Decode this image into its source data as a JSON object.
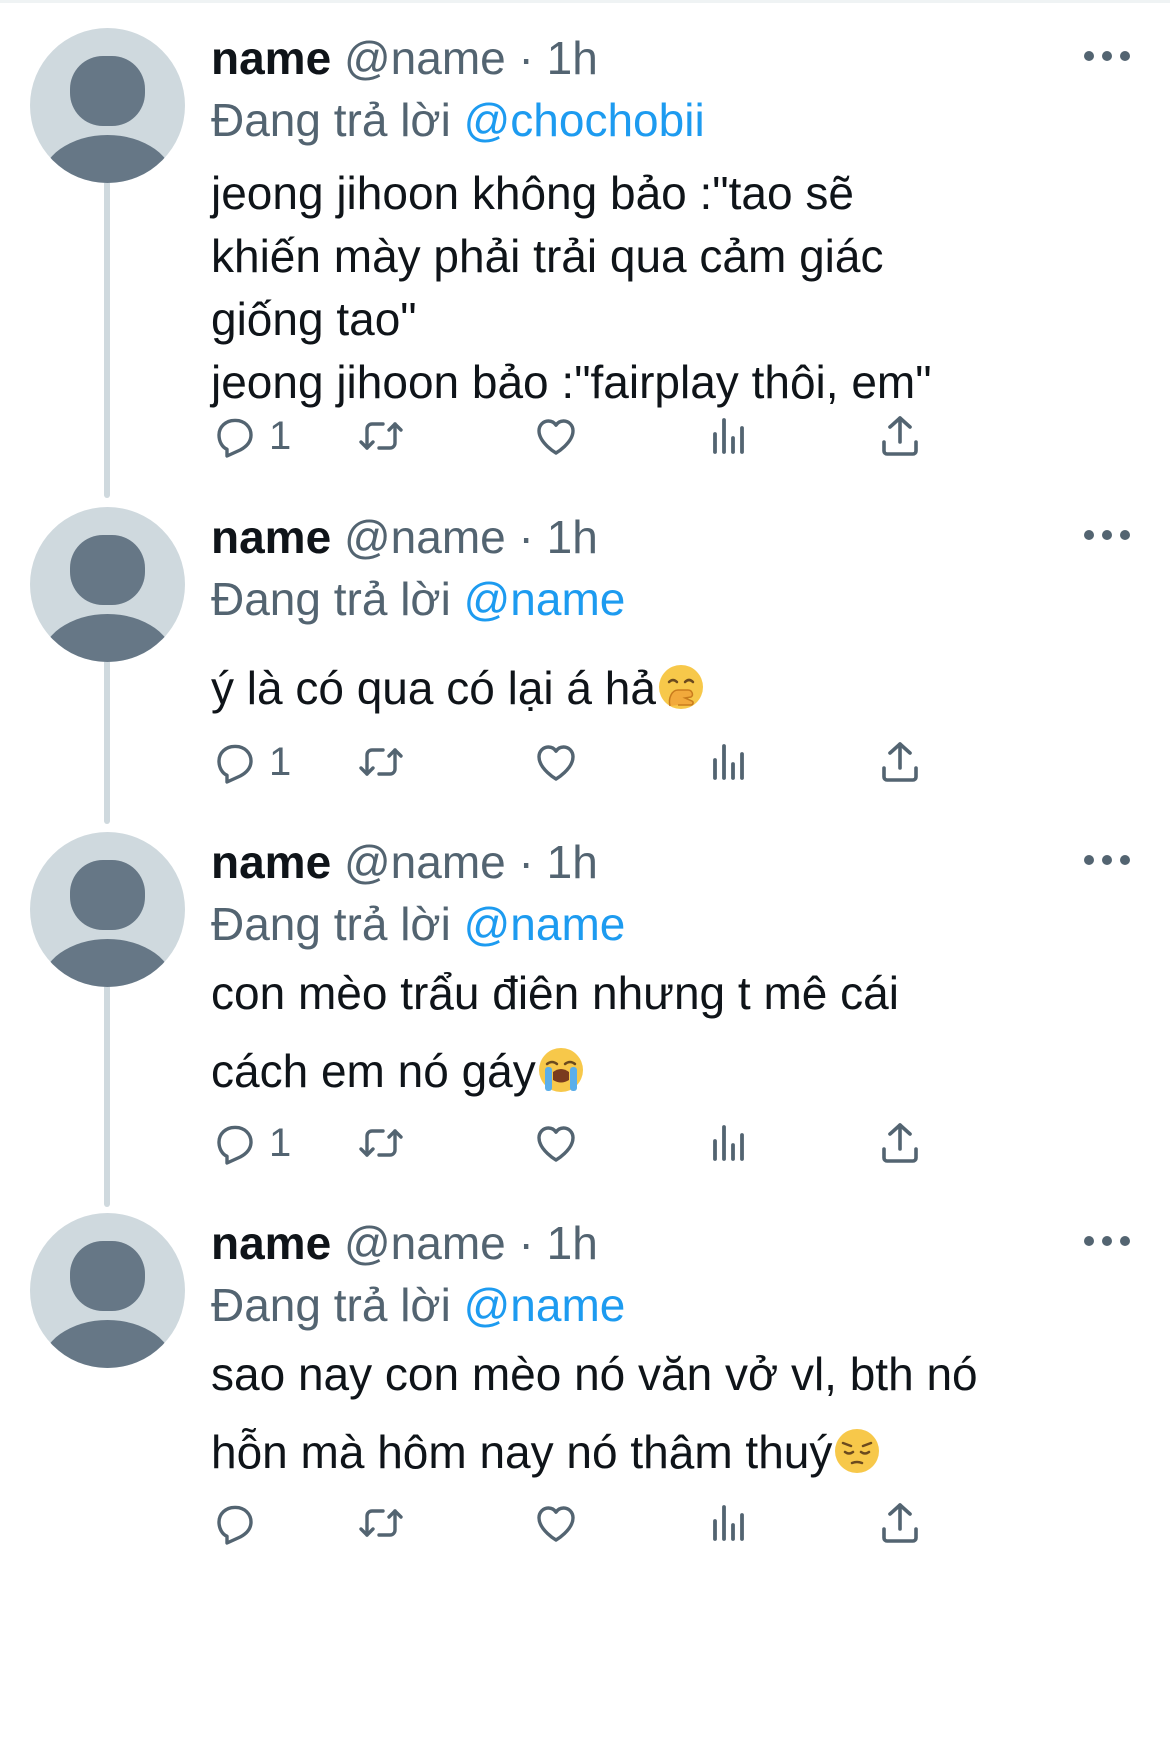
{
  "tweets": [
    {
      "name": "name",
      "handle": "@name",
      "dot": "·",
      "time": "1h",
      "reply_prefix": "Đang trả lời",
      "reply_to": "@chochobii",
      "text": "jeong jihoon không bảo :\"tao sẽ\nkhiến mày phải trải qua cảm giác\ngiống tao\"\njeong jihoon bảo :\"fairplay thôi, em\"",
      "emoji": "",
      "reply_count": "1"
    },
    {
      "name": "name",
      "handle": "@name",
      "dot": "·",
      "time": "1h",
      "reply_prefix": "Đang trả lời",
      "reply_to": "@name",
      "text": "ý là có qua có lại á hả",
      "emoji": "hand-over-mouth-emoji",
      "reply_count": "1"
    },
    {
      "name": "name",
      "handle": "@name",
      "dot": "·",
      "time": "1h",
      "reply_prefix": "Đang trả lời",
      "reply_to": "@name",
      "text": "con mèo trẩu điên nhưng t mê cái\ncách em nó gáy",
      "emoji": "loudly-crying-emoji",
      "reply_count": "1"
    },
    {
      "name": "name",
      "handle": "@name",
      "dot": "·",
      "time": "1h",
      "reply_prefix": "Đang trả lời",
      "reply_to": "@name",
      "text": "sao nay con mèo nó văn vở vl, bth nó\nhỗn mà hôm nay nó thâm thuý",
      "emoji": "pensive-emoji",
      "reply_count": ""
    }
  ],
  "icons": {
    "reply": "reply-icon",
    "retweet": "retweet-icon",
    "like": "like-icon",
    "views": "views-icon",
    "share": "share-icon",
    "more": "more-icon"
  },
  "colors": {
    "text": "#0f1419",
    "secondary": "#536471",
    "link": "#1d9bf0",
    "avatar_bg": "#cfd9de",
    "avatar_fg": "#667786",
    "connector": "#cfd9de"
  }
}
